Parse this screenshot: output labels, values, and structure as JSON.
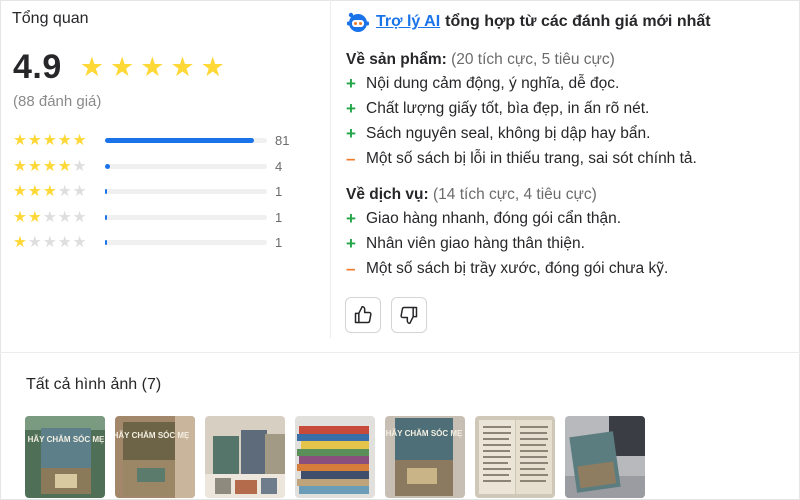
{
  "overview": {
    "title": "Tổng quan",
    "score": "4.9",
    "review_count": "(88 đánh giá)",
    "distribution": [
      {
        "stars": 5,
        "count": "81",
        "fraction": 0.92
      },
      {
        "stars": 4,
        "count": "4",
        "fraction": 0.03
      },
      {
        "stars": 3,
        "count": "1",
        "fraction": 0.01
      },
      {
        "stars": 2,
        "count": "1",
        "fraction": 0.01
      },
      {
        "stars": 1,
        "count": "1",
        "fraction": 0.01
      }
    ]
  },
  "ai_summary": {
    "icon": "robot-icon",
    "link_label": "Trợ lý AI",
    "heading_rest": "tổng hợp từ các đánh giá mới nhất",
    "product": {
      "label": "Về sản phẩm:",
      "stats": "(20 tích cực, 5 tiêu cực)",
      "items": [
        {
          "sign": "+",
          "text": "Nội dung cảm động, ý nghĩa, dễ đọc."
        },
        {
          "sign": "+",
          "text": "Chất lượng giấy tốt, bìa đẹp, in ấn rõ nét."
        },
        {
          "sign": "+",
          "text": "Sách nguyên seal, không bị dập hay bẩn."
        },
        {
          "sign": "–",
          "text": "Một số sách bị lỗi in thiếu trang, sai sót chính tả."
        }
      ]
    },
    "service": {
      "label": "Về dịch vụ:",
      "stats": "(14 tích cực, 4 tiêu cực)",
      "items": [
        {
          "sign": "+",
          "text": "Giao hàng nhanh, đóng gói cẩn thận."
        },
        {
          "sign": "+",
          "text": "Nhân viên giao hàng thân thiện."
        },
        {
          "sign": "–",
          "text": "Một số sách bị trầy xước, đóng gói chưa kỹ."
        }
      ]
    },
    "feedback": {
      "like_icon": "thumbs-up-icon",
      "dislike_icon": "thumbs-down-icon"
    }
  },
  "images": {
    "title": "Tất cả hình ảnh (7)",
    "thumbnails": [
      {
        "name": "review-photo-1",
        "cover_text": "HÃY CHĂM SÓC MẸ"
      },
      {
        "name": "review-photo-2",
        "cover_text": "HÃY CHĂM SÓC MẸ"
      },
      {
        "name": "review-photo-3",
        "cover_text": ""
      },
      {
        "name": "review-photo-4",
        "cover_text": ""
      },
      {
        "name": "review-photo-5",
        "cover_text": "HÃY CHĂM SÓC MẸ"
      },
      {
        "name": "review-photo-6",
        "cover_text": ""
      },
      {
        "name": "review-photo-7",
        "cover_text": ""
      }
    ]
  },
  "colors": {
    "star_gold": "#fdd836",
    "star_empty": "#dedede",
    "bar_blue": "#1a73e8",
    "positive_green": "#22a447",
    "negative_orange": "#f07b2c",
    "link_blue": "#1a73e8"
  }
}
